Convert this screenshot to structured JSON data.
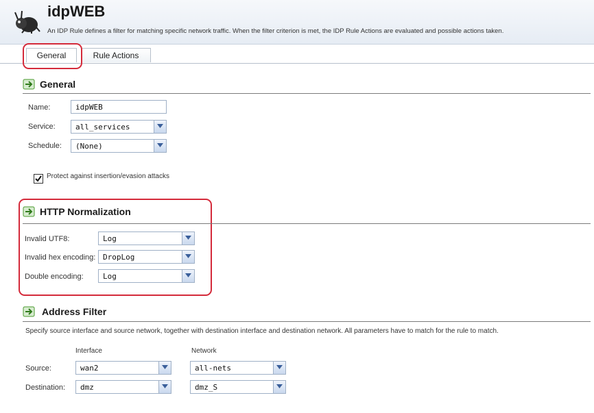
{
  "header": {
    "title": "idpWEB",
    "subtitle": "An IDP Rule defines a filter for matching specific network traffic. When the filter criterion is met, the IDP Rule Actions are evaluated and possible actions taken."
  },
  "tabs": [
    {
      "label": "General",
      "active": true
    },
    {
      "label": "Rule Actions",
      "active": false
    }
  ],
  "general": {
    "section_title": "General",
    "name_label": "Name:",
    "name_value": "idpWEB",
    "service_label": "Service:",
    "service_value": "all_services",
    "schedule_label": "Schedule:",
    "schedule_value": "(None)",
    "protect_label": "Protect against insertion/evasion attacks",
    "protect_checked": true
  },
  "http": {
    "section_title": "HTTP Normalization",
    "invalid_utf8_label": "Invalid UTF8:",
    "invalid_utf8_value": "Log",
    "invalid_hex_label": "Invalid hex encoding:",
    "invalid_hex_value": "DropLog",
    "double_label": "Double encoding:",
    "double_value": "Log"
  },
  "address": {
    "section_title": "Address Filter",
    "description": "Specify source interface and source network, together with destination interface and destination network. All parameters have to match for the rule to match.",
    "col_interface": "Interface",
    "col_network": "Network",
    "source_label": "Source:",
    "source_interface": "wan2",
    "source_network": "all-nets",
    "destination_label": "Destination:",
    "destination_interface": "dmz",
    "destination_network": "dmz_S"
  },
  "colors": {
    "highlight": "#d42a3a",
    "field_border": "#9fb0c6",
    "section_icon": "#4a9a2e"
  },
  "icons": [
    "app-bug-icon",
    "section-arrow-icon",
    "dropdown-arrow-icon",
    "checkmark-icon"
  ]
}
